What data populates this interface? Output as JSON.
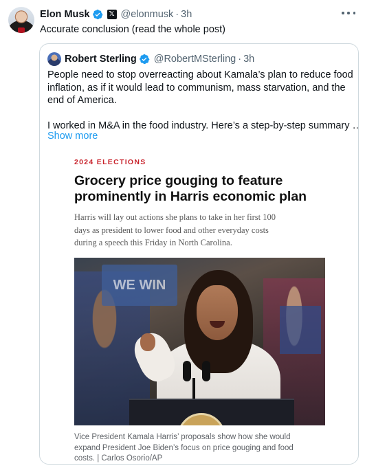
{
  "tweet": {
    "author_name": "Elon Musk",
    "author_handle": "@elonmusk",
    "time": "3h",
    "text": "Accurate conclusion (read the whole post)"
  },
  "quoted": {
    "author_name": "Robert Sterling",
    "author_handle": "@RobertMSterling",
    "time": "3h",
    "lines": [
      "People need to stop overreacting about Kamala’s plan to reduce food",
      "inflation, as if it would lead to communism, mass starvation, and the",
      "end of America.",
      "I worked in M&A in the food industry. Here’s a step-by-step summary …"
    ],
    "show_more": "Show more"
  },
  "article": {
    "kicker": "2024 ELECTIONS",
    "headline_lines": [
      "Grocery price gouging to feature",
      "prominently in Harris economic plan"
    ],
    "dek_lines": [
      "Harris will lay out actions she plans to take in her first 100",
      "days as president to lower food and other everyday costs",
      "during a speech this Friday in North Carolina."
    ],
    "photo_sign_text": "WE WIN",
    "caption_lines": [
      "Vice President Kamala Harris’ proposals show how she would",
      "expand President Joe Biden’s focus on price gouging and food",
      "costs. | Carlos Osorio/AP"
    ]
  },
  "colors": {
    "text": "#0f1419",
    "secondary": "#536471",
    "link": "#1d9bf0",
    "verified": "#1d9bf0",
    "border": "#cfd9de",
    "kicker": "#c8232c"
  },
  "icons": {
    "verified": "verified-badge-icon",
    "x_affiliate": "x-logo-icon",
    "more": "more-horizontal-icon"
  }
}
